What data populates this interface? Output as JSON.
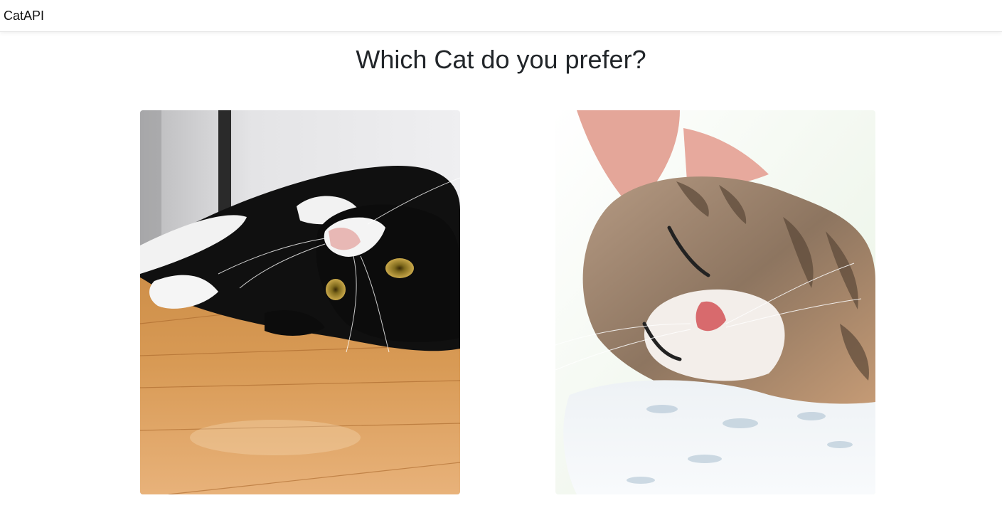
{
  "navbar": {
    "brand": "CatAPI"
  },
  "main": {
    "heading": "Which Cat do you prefer?",
    "choices": [
      {
        "subject": "black-and-white cat lying upside down on a wooden floor"
      },
      {
        "subject": "tabby kitten sleeping on a pillow"
      }
    ]
  }
}
